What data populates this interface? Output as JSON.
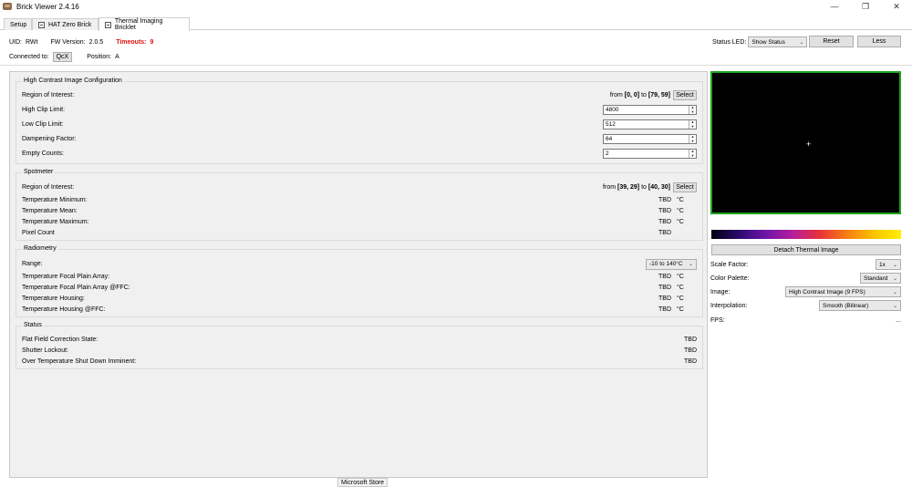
{
  "window": {
    "title": "Brick Viewer 2.4.16",
    "minimize": "—",
    "maximize": "❐",
    "close": "✕"
  },
  "tabs": [
    {
      "label": "Setup"
    },
    {
      "label": "HAT Zero Brick"
    },
    {
      "label": "Thermal Imaging Bricklet"
    }
  ],
  "info": {
    "uid_label": "UID:",
    "uid_value": "RWt",
    "fw_label": "FW Version:",
    "fw_value": "2.0.5",
    "timeouts_label": "Timeouts:",
    "timeouts_value": "9",
    "connected_label": "Connected to:",
    "connected_value": "QcX",
    "position_label": "Position:",
    "position_value": "A"
  },
  "status_led": {
    "label": "Status LED:",
    "selected": "Show Status",
    "reset": "Reset",
    "less": "Less"
  },
  "high_contrast": {
    "title": "High Contrast Image Configuration",
    "roi_label": "Region of Interest:",
    "roi_from": "from",
    "roi_a": "[0, 0]",
    "roi_to": "to",
    "roi_b": "[79, 59]",
    "select": "Select",
    "high_clip_label": "High Clip Limit:",
    "high_clip_value": "4800",
    "low_clip_label": "Low Clip Limit:",
    "low_clip_value": "512",
    "dampening_label": "Dampening Factor:",
    "dampening_value": "64",
    "empty_label": "Empty Counts:",
    "empty_value": "2",
    "spin_up": "▲",
    "spin_down": "▼"
  },
  "spotmeter": {
    "title": "Spotmeter",
    "roi_label": "Region of Interest:",
    "roi_from": "from",
    "roi_a": "[39, 29]",
    "roi_to": "to",
    "roi_b": "[40, 30]",
    "select": "Select",
    "rows": [
      {
        "label": "Temperature Minimum:",
        "value": "TBD",
        "unit": "°C"
      },
      {
        "label": "Temperature Mean:",
        "value": "TBD",
        "unit": "°C"
      },
      {
        "label": "Temperature Maximum:",
        "value": "TBD",
        "unit": "°C"
      },
      {
        "label": "Pixel Count",
        "value": "TBD",
        "unit": ""
      }
    ]
  },
  "radiometry": {
    "title": "Radiometry",
    "range_label": "Range:",
    "range_value": "-10 to 140°C",
    "rows": [
      {
        "label": "Temperature Focal Plain Array:",
        "value": "TBD",
        "unit": "°C"
      },
      {
        "label": "Temperature Focal Plain Array @FFC:",
        "value": "TBD",
        "unit": "°C"
      },
      {
        "label": "Temperature Housing:",
        "value": "TBD",
        "unit": "°C"
      },
      {
        "label": "Temperature Housing @FFC:",
        "value": "TBD",
        "unit": "°C"
      }
    ]
  },
  "status": {
    "title": "Status",
    "rows": [
      {
        "label": "Flat Field Correction State:",
        "value": "TBD"
      },
      {
        "label": "Shutter Lockout:",
        "value": "TBD"
      },
      {
        "label": "Over Temperature Shut Down Imminent:",
        "value": "TBD"
      }
    ]
  },
  "right": {
    "crosshair": "+",
    "detach": "Detach Thermal Image",
    "scale_label": "Scale Factor:",
    "scale_value": "1x",
    "palette_label": "Color Palette:",
    "palette_value": "Standard",
    "image_label": "Image:",
    "image_value": "High Contrast Image (9 FPS)",
    "interp_label": "Interpolation:",
    "interp_value": "Smooth (Bilinear)",
    "fps_label": "FPS:",
    "fps_value": "..."
  },
  "taskbar": {
    "tooltip": "Microsoft Store"
  },
  "colors": {
    "timeouts": "#e01010",
    "thermal_border": "#1fa31f",
    "panel_bg": "#f0f0f0"
  }
}
